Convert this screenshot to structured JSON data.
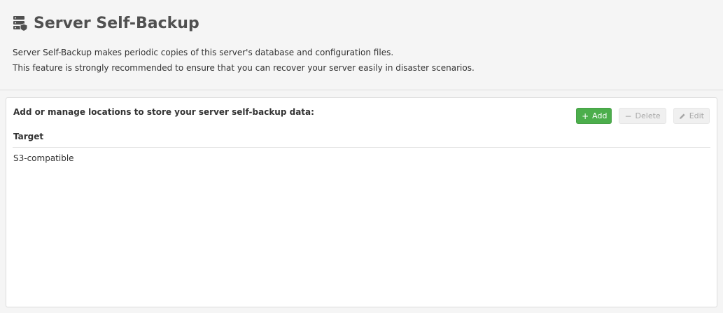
{
  "page": {
    "title": "Server Self-Backup",
    "icon": "server-backup-icon",
    "description_line1": "Server Self-Backup makes periodic copies of this server's database and configuration files.",
    "description_line2": "This feature is strongly recommended to ensure that you can recover your server easily in disaster scenarios."
  },
  "panel": {
    "heading": "Add or manage locations to store your server self-backup data:",
    "toolbar": {
      "add_label": "Add",
      "add_icon": "plus-icon",
      "delete_label": "Delete",
      "delete_icon": "minus-icon",
      "edit_label": "Edit",
      "edit_icon": "pencil-icon"
    },
    "table": {
      "columns": [
        "Target"
      ],
      "rows": [
        [
          "S3-compatible"
        ]
      ]
    }
  },
  "colors": {
    "add_button": "#4cae4c",
    "disabled_button": "#f0f0f0",
    "header_background": "#f5f5f5",
    "panel_background": "#ffffff"
  }
}
